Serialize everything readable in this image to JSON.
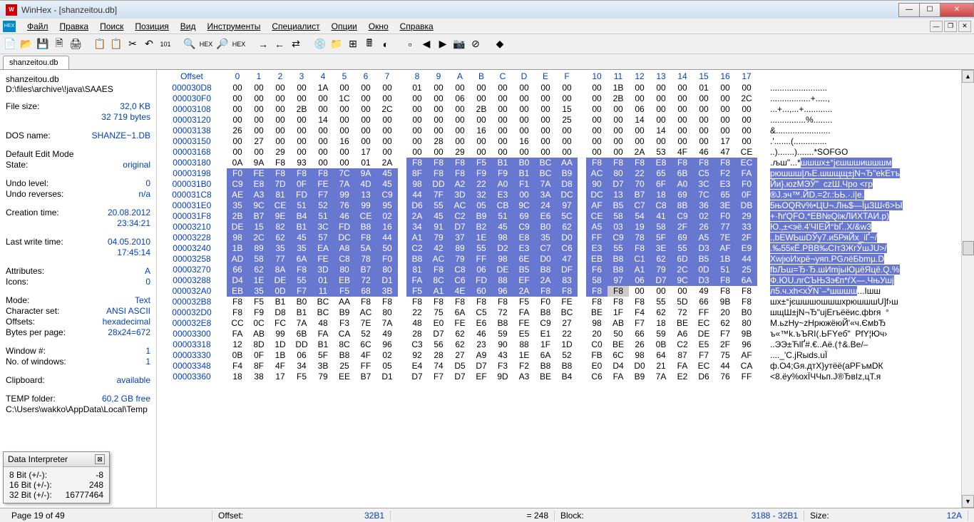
{
  "title": "WinHex - [shanzeitou.db]",
  "menu": [
    "Файл",
    "Правка",
    "Поиск",
    "Позиция",
    "Вид",
    "Инструменты",
    "Специалист",
    "Опции",
    "Окно",
    "Справка"
  ],
  "tab": "shanzeitou.db",
  "sidebar": {
    "filename": "shanzeitou.db",
    "path": "D:\\files\\archive\\!java\\SAAES",
    "rows1": [
      {
        "l": "File size:",
        "v": "32,0 KB"
      },
      {
        "l": "",
        "v": "32 719 bytes"
      }
    ],
    "rows2": [
      {
        "l": "DOS name:",
        "v": "SHANZE~1.DB"
      }
    ],
    "rows3": [
      {
        "l": "Default Edit Mode",
        "v": ""
      },
      {
        "l": "State:",
        "v": "original"
      }
    ],
    "rows4": [
      {
        "l": "Undo level:",
        "v": "0"
      },
      {
        "l": "Undo reverses:",
        "v": "n/a"
      }
    ],
    "rows5": [
      {
        "l": "Creation time:",
        "v": "20.08.2012"
      },
      {
        "l": "",
        "v": "23:34:21"
      }
    ],
    "rows6": [
      {
        "l": "Last write time:",
        "v": "04.05.2010"
      },
      {
        "l": "",
        "v": "17:45:14"
      }
    ],
    "rows7": [
      {
        "l": "Attributes:",
        "v": "A"
      },
      {
        "l": "Icons:",
        "v": "0"
      }
    ],
    "rows8": [
      {
        "l": "Mode:",
        "v": "Text"
      },
      {
        "l": "Character set:",
        "v": "ANSI ASCII"
      },
      {
        "l": "Offsets:",
        "v": "hexadecimal"
      },
      {
        "l": "Bytes per page:",
        "v": "28x24=672"
      }
    ],
    "rows9": [
      {
        "l": "Window #:",
        "v": "1"
      },
      {
        "l": "No. of windows:",
        "v": "1"
      }
    ],
    "rows10": [
      {
        "l": "Clipboard:",
        "v": "available"
      }
    ],
    "rows11": [
      {
        "l": "TEMP folder:",
        "v": "60,2 GB free"
      },
      {
        "l": "C:\\Users\\wakko\\AppData\\Local\\Temp",
        "v": ""
      }
    ]
  },
  "hex": {
    "header_label": "Offset",
    "cols": [
      "0",
      "1",
      "2",
      "3",
      "4",
      "5",
      "6",
      "7",
      "8",
      "9",
      "A",
      "B",
      "C",
      "D",
      "E",
      "F",
      "10",
      "11",
      "12",
      "13",
      "14",
      "15",
      "16",
      "17"
    ],
    "rows": [
      {
        "o": "000030D8",
        "b": [
          "00",
          "00",
          "00",
          "00",
          "1A",
          "00",
          "00",
          "00",
          "01",
          "00",
          "00",
          "00",
          "00",
          "00",
          "00",
          "00",
          "00",
          "1B",
          "00",
          "00",
          "00",
          "01",
          "00",
          "00"
        ],
        "a": "........................"
      },
      {
        "o": "000030F0",
        "b": [
          "00",
          "00",
          "00",
          "00",
          "00",
          "1C",
          "00",
          "00",
          "00",
          "00",
          "06",
          "00",
          "00",
          "00",
          "00",
          "00",
          "00",
          "2B",
          "00",
          "00",
          "00",
          "00",
          "00",
          "2C"
        ],
        "a": ".................+.....,"
      },
      {
        "o": "00003108",
        "b": [
          "00",
          "00",
          "00",
          "2B",
          "00",
          "00",
          "00",
          "2C",
          "00",
          "00",
          "00",
          "2B",
          "00",
          "00",
          "00",
          "15",
          "00",
          "00",
          "06",
          "00",
          "00",
          "00",
          "00",
          "00"
        ],
        "a": "...+...,...+............"
      },
      {
        "o": "00003120",
        "b": [
          "00",
          "00",
          "00",
          "00",
          "14",
          "00",
          "00",
          "00",
          "00",
          "00",
          "00",
          "00",
          "00",
          "00",
          "00",
          "25",
          "00",
          "00",
          "14",
          "00",
          "00",
          "00",
          "00",
          "00"
        ],
        "a": "...............%........"
      },
      {
        "o": "00003138",
        "b": [
          "26",
          "00",
          "00",
          "00",
          "00",
          "00",
          "00",
          "00",
          "00",
          "00",
          "00",
          "16",
          "00",
          "00",
          "00",
          "00",
          "00",
          "00",
          "00",
          "14",
          "00",
          "00",
          "00",
          "00"
        ],
        "a": "&......................."
      },
      {
        "o": "00003150",
        "b": [
          "00",
          "27",
          "00",
          "00",
          "00",
          "16",
          "00",
          "00",
          "00",
          "28",
          "00",
          "00",
          "00",
          "16",
          "00",
          "00",
          "00",
          "00",
          "00",
          "00",
          "00",
          "00",
          "17",
          "00"
        ],
        "a": ".'.......(.............."
      },
      {
        "o": "00003168",
        "b": [
          "00",
          "00",
          "29",
          "00",
          "00",
          "00",
          "17",
          "00",
          "00",
          "00",
          "29",
          "00",
          "00",
          "00",
          "00",
          "00",
          "00",
          "00",
          "2A",
          "53",
          "4F",
          "46",
          "47",
          "CE"
        ],
        "a": "..).......).......*SOFGО"
      },
      {
        "o": "00003180",
        "b": [
          "0A",
          "9A",
          "F8",
          "93",
          "00",
          "00",
          "01",
          "2A",
          "F8",
          "F8",
          "F8",
          "F5",
          "B1",
          "B0",
          "BC",
          "AA",
          "F8",
          "F8",
          "F8",
          "E8",
          "F8",
          "F8",
          "F8",
          "EC"
        ],
        "a": ".љш\"...*шшшх±°јєшшшишшшм",
        "s": 8
      },
      {
        "o": "00003198",
        "b": [
          "F0",
          "FE",
          "F8",
          "F8",
          "F8",
          "7C",
          "9A",
          "45",
          "8F",
          "F8",
          "F8",
          "F9",
          "F9",
          "B1",
          "BC",
          "B9",
          "AC",
          "80",
          "22",
          "65",
          "6B",
          "C5",
          "F2",
          "FA"
        ],
        "a": "рюшшш|љE.шшщщ±јN¬Ђ\"ekЕтъ",
        "s": 0
      },
      {
        "o": "000031B0",
        "b": [
          "C9",
          "E8",
          "7D",
          "0F",
          "FE",
          "7A",
          "4D",
          "45",
          "98",
          "DD",
          "A2",
          "22",
          "A0",
          "F1",
          "7A",
          "D8",
          "90",
          "D7",
          "70",
          "6F",
          "A0",
          "3C",
          "E3",
          "F0"
        ],
        "a": "Йи}.юzMЭЎ\"  czШ.Чро <гр",
        "s": 0
      },
      {
        "o": "000031C8",
        "b": [
          "AE",
          "A3",
          "81",
          "FD",
          "F7",
          "99",
          "13",
          "C9",
          "44",
          "7F",
          "3D",
          "32",
          "E3",
          "00",
          "3A",
          "DC",
          "DC",
          "13",
          "B7",
          "18",
          "69",
          "7C",
          "65",
          "0F"
        ],
        "a": "®J.эч™.ЙD.=2г.:ЬЬ.·.i|e.",
        "s": 0
      },
      {
        "o": "000031E0",
        "b": [
          "35",
          "9C",
          "CE",
          "51",
          "52",
          "76",
          "99",
          "95",
          "D6",
          "55",
          "AC",
          "05",
          "CB",
          "9C",
          "24",
          "97",
          "AF",
          "B5",
          "C7",
          "C8",
          "8B",
          "36",
          "3E",
          "DB"
        ],
        "a": "5њОQRv%•ЦU¬.Лњ$—ЇµЗШ‹6>Ы",
        "s": 0
      },
      {
        "o": "000031F8",
        "b": [
          "2B",
          "B7",
          "9E",
          "B4",
          "51",
          "46",
          "CE",
          "02",
          "2A",
          "45",
          "C2",
          "B9",
          "51",
          "69",
          "E6",
          "5C",
          "CE",
          "58",
          "54",
          "41",
          "C9",
          "02",
          "F0",
          "29"
        ],
        "a": "+·ћґQFО.*ЕВ№QiжЛИXTAИ.р)",
        "s": 0
      },
      {
        "o": "00003210",
        "b": [
          "DE",
          "15",
          "82",
          "B1",
          "3C",
          "FD",
          "B8",
          "16",
          "34",
          "91",
          "D7",
          "B2",
          "45",
          "C9",
          "B0",
          "62",
          "A5",
          "03",
          "19",
          "58",
          "2F",
          "26",
          "77",
          "33"
        ],
        "a": "Ю.‚±<эё.4'ЧІЕЙ°bҐ..X/&w3",
        "s": 0
      },
      {
        "o": "00003228",
        "b": [
          "98",
          "2C",
          "62",
          "45",
          "57",
          "DC",
          "F8",
          "44",
          "A1",
          "79",
          "37",
          "1E",
          "98",
          "E8",
          "35",
          "D0",
          "FF",
          "C9",
          "78",
          "5F",
          "69",
          "A5",
          "7E",
          "2F"
        ],
        "a": ".,bEWЬшDЎy7.и5РяЙx_iҐ~/",
        "s": 0
      },
      {
        "o": "00003240",
        "b": [
          "1B",
          "89",
          "35",
          "35",
          "EA",
          "A8",
          "5A",
          "50",
          "C2",
          "42",
          "89",
          "55",
          "D2",
          "E3",
          "C7",
          "C6",
          "E3",
          "55",
          "F8",
          "3E",
          "55",
          "D3",
          "AF",
          "E9"
        ],
        "a": ".‰55кЁ.РВВ‰СІтЗЖгЎшЈU>/",
        "s": 0
      },
      {
        "o": "00003258",
        "b": [
          "AD",
          "58",
          "77",
          "6A",
          "FE",
          "C8",
          "78",
          "F0",
          "B8",
          "AC",
          "79",
          "FF",
          "98",
          "6E",
          "D0",
          "47",
          "EB",
          "B8",
          "C1",
          "62",
          "6D",
          "B5",
          "1B",
          "44"
        ],
        "a": "­XwjюИхрё¬уяп.PGлёБbmµ.D",
        "s": 0
      },
      {
        "o": "00003270",
        "b": [
          "66",
          "62",
          "8A",
          "F8",
          "3D",
          "80",
          "B7",
          "80",
          "81",
          "F8",
          "C8",
          "06",
          "DE",
          "B5",
          "B8",
          "DF",
          "F6",
          "B8",
          "A1",
          "79",
          "2C",
          "0D",
          "51",
          "25"
        ],
        "a": "fbЉш=Ђ·Ђ.шИmјыЮµёЯцё.Q.%",
        "s": 0
      },
      {
        "o": "00003288",
        "b": [
          "D4",
          "1E",
          "DE",
          "55",
          "01",
          "EB",
          "72",
          "D1",
          "FA",
          "8C",
          "C6",
          "FD",
          "88",
          "EF",
          "2A",
          "83",
          "58",
          "97",
          "06",
          "D7",
          "9C",
          "D3",
          "F8",
          "6A"
        ],
        "a": "Ф.ЮU.лrСЪЊЗэ€п*ѓX—.ЧњУшj",
        "s": 0
      },
      {
        "o": "000032A0",
        "b": [
          "EB",
          "35",
          "0D",
          "F7",
          "11",
          "F5",
          "68",
          "3B",
          "F5",
          "A1",
          "4E",
          "60",
          "96",
          "2A",
          "F8",
          "F8",
          "F8",
          "F8",
          "00",
          "00",
          "00",
          "49",
          "F8",
          "F8"
        ],
        "a": "л5.ч.хh<хЎN`–*шшшш...Iшш",
        "s": 0,
        "e": 18,
        "c": 17
      },
      {
        "o": "000032B8",
        "b": [
          "F8",
          "F5",
          "B1",
          "B0",
          "BC",
          "AA",
          "F8",
          "F8",
          "F8",
          "F8",
          "F8",
          "F8",
          "F8",
          "F5",
          "F0",
          "FE",
          "F8",
          "F8",
          "F8",
          "55",
          "5D",
          "66",
          "9B",
          "F8"
        ],
        "a": "шх±°јєшшшошшшхрюшшшU]f›ш"
      },
      {
        "o": "000032D0",
        "b": [
          "F8",
          "F9",
          "D8",
          "B1",
          "BC",
          "B9",
          "AC",
          "80",
          "22",
          "75",
          "6A",
          "C5",
          "72",
          "FA",
          "B8",
          "BC",
          "BE",
          "1F",
          "F4",
          "62",
          "72",
          "FF",
          "20",
          "B0"
        ],
        "a": "шщШ±јN¬Ђ\"ujЕrъёёис.фbrя  °"
      },
      {
        "o": "000032E8",
        "b": [
          "CC",
          "0C",
          "FC",
          "7A",
          "48",
          "F3",
          "7E",
          "7A",
          "48",
          "E0",
          "FE",
          "E6",
          "B8",
          "FE",
          "C9",
          "27",
          "98",
          "AB",
          "F7",
          "18",
          "BE",
          "EC",
          "62",
          "80"
        ],
        "a": "М.ьzНу~zНрюжёюЙ'«ч.ЄмbЂ"
      },
      {
        "o": "00003300",
        "b": [
          "FA",
          "AB",
          "99",
          "6B",
          "FA",
          "CA",
          "52",
          "49",
          "28",
          "D7",
          "62",
          "46",
          "59",
          "E5",
          "E1",
          "22",
          "20",
          "50",
          "66",
          "59",
          "A6",
          "DE",
          "F7",
          "9B"
        ],
        "a": "ъ«™k.ъЪRI(.ЬFYеб\"  PfY¦Юч›"
      },
      {
        "o": "00003318",
        "b": [
          "12",
          "8D",
          "1D",
          "DD",
          "B1",
          "8C",
          "6C",
          "96",
          "C3",
          "56",
          "62",
          "23",
          "90",
          "88",
          "1F",
          "1D",
          "C0",
          "BE",
          "26",
          "0B",
          "C2",
          "E5",
          "2F",
          "96"
        ],
        "a": "..ЭЭ±ЋlҐ#.€..Аё.(†&.Be/–"
      },
      {
        "o": "00003330",
        "b": [
          "0B",
          "0F",
          "1B",
          "06",
          "5F",
          "B8",
          "4F",
          "02",
          "92",
          "28",
          "27",
          "A9",
          "43",
          "1E",
          "6A",
          "52",
          "FB",
          "6C",
          "98",
          "64",
          "87",
          "F7",
          "75",
          "AF"
        ],
        "a": "...._'C.jRыds.uЇ"
      },
      {
        "o": "00003348",
        "b": [
          "F4",
          "8F",
          "4F",
          "34",
          "3B",
          "25",
          "FF",
          "05",
          "E4",
          "74",
          "D5",
          "D7",
          "F3",
          "F2",
          "B8",
          "B8",
          "E0",
          "D4",
          "D0",
          "21",
          "FA",
          "EC",
          "44",
          "CA"
        ],
        "a": "ф.O4;Gя.дтX}утёё(аРFъмDК"
      },
      {
        "o": "00003360",
        "b": [
          "18",
          "38",
          "17",
          "F5",
          "79",
          "EE",
          "B7",
          "D1",
          "D7",
          "F7",
          "D7",
          "EF",
          "9D",
          "A3",
          "BE",
          "B4",
          "C6",
          "FA",
          "B9",
          "7A",
          "E2",
          "D6",
          "76",
          "FF"
        ],
        "a": "<8.ёу%охЇЧЧьп.J®ЂвІz,цТ.я"
      }
    ]
  },
  "interpreter": {
    "title": "Data Interpreter",
    "rows": [
      {
        "l": "8 Bit (+/-):",
        "v": "-8"
      },
      {
        "l": "16 Bit (+/-):",
        "v": "248"
      },
      {
        "l": "32 Bit (+/-):",
        "v": "16777464"
      }
    ]
  },
  "status": {
    "page": "Page 19 of 49",
    "offset_l": "Offset:",
    "offset_v": "32B1",
    "eq": "= 248",
    "block_l": "Block:",
    "block_v": "3188 - 32B1",
    "size_l": "Size:",
    "size_v": "12A"
  }
}
